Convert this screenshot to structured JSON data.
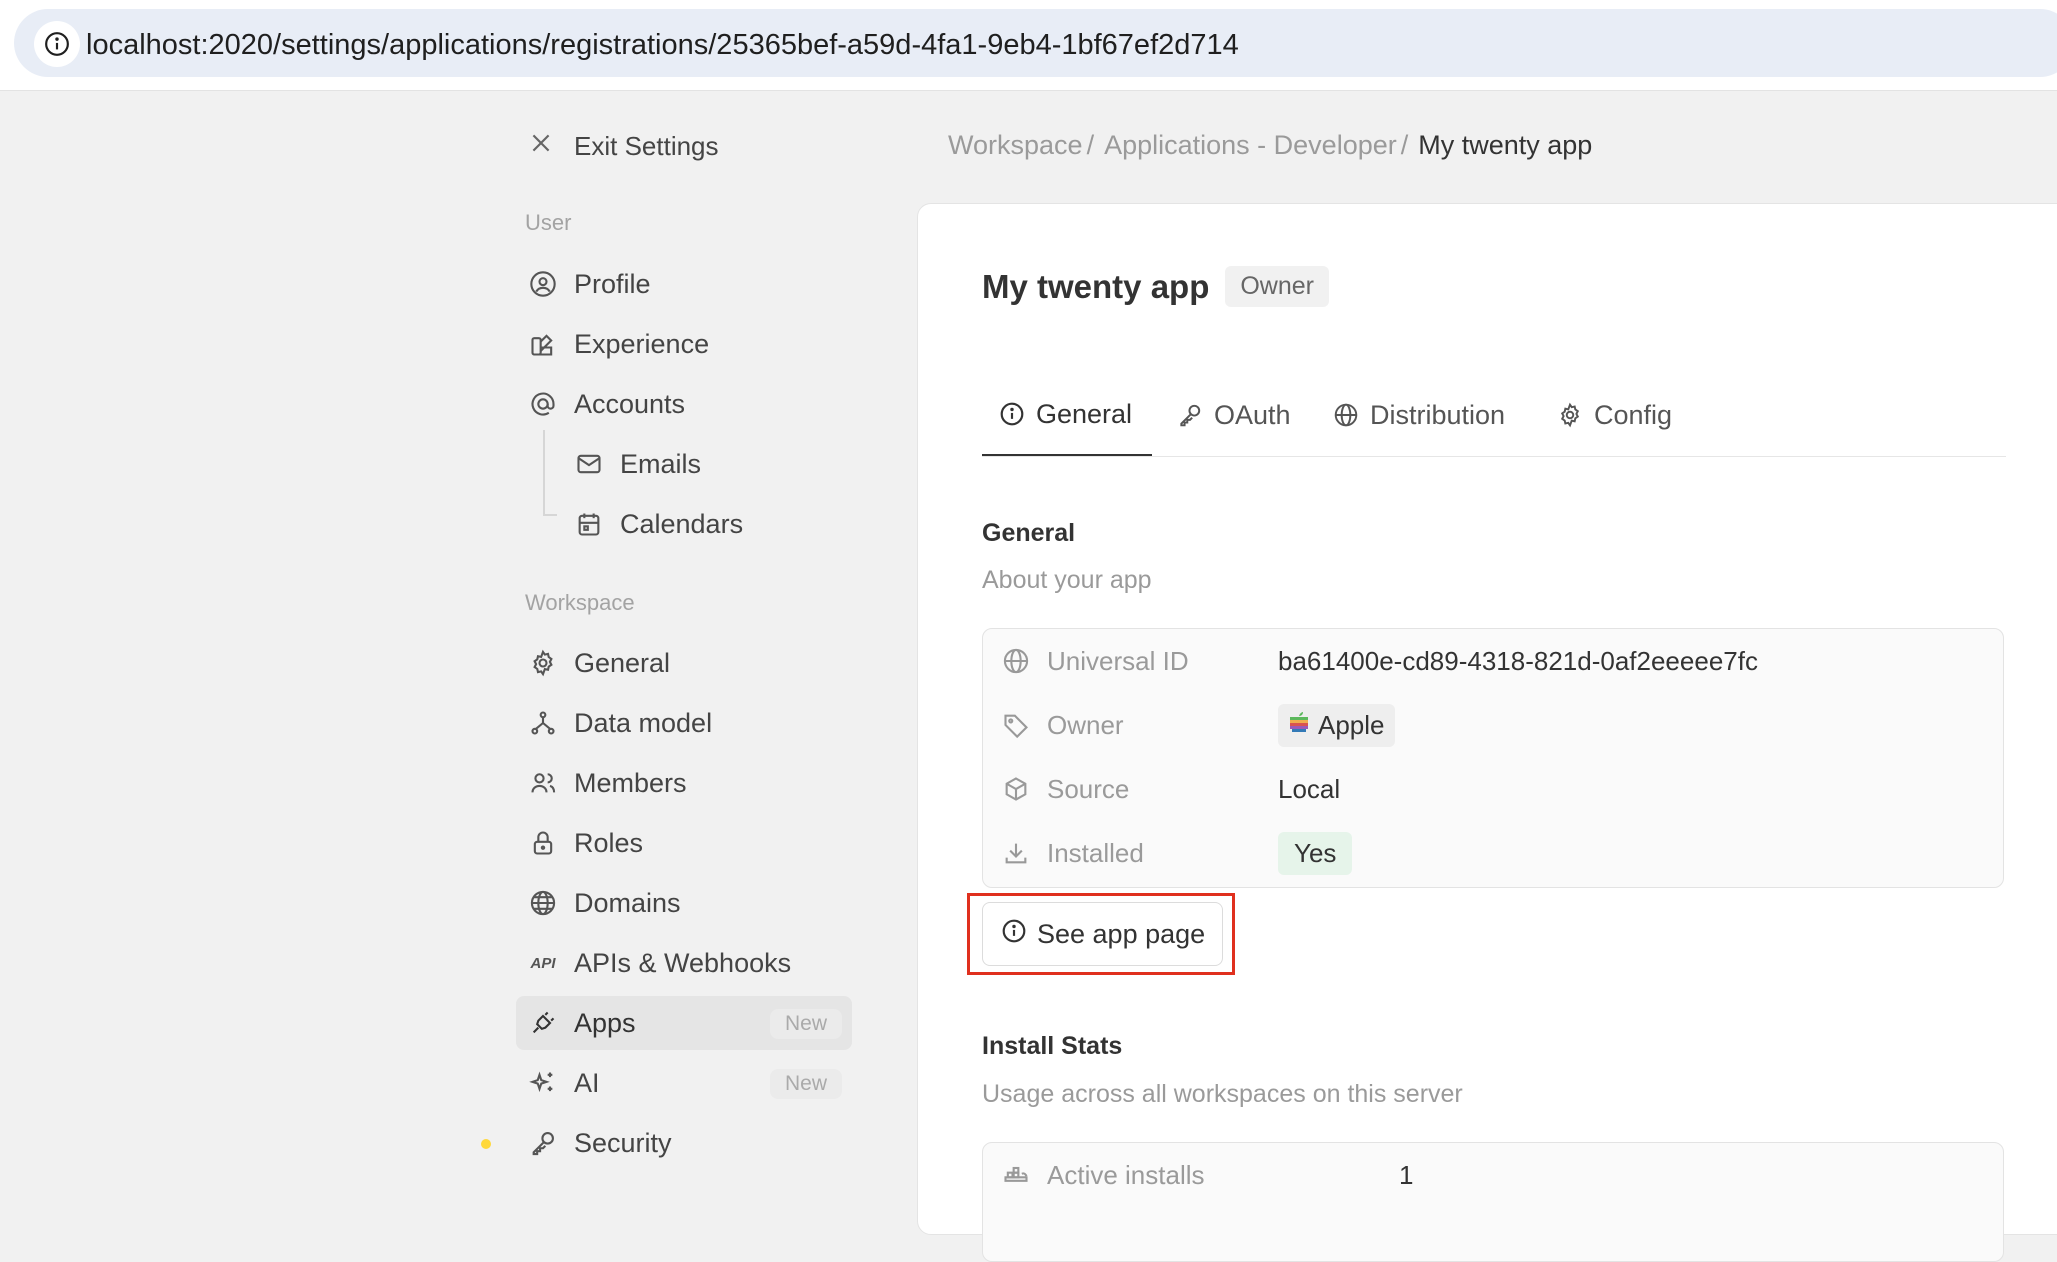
{
  "browser": {
    "url": "localhost:2020/settings/applications/registrations/25365bef-a59d-4fa1-9eb4-1bf67ef2d714"
  },
  "sidebar": {
    "exit_label": "Exit Settings",
    "user_section": "User",
    "user_items": [
      {
        "label": "Profile",
        "icon": "user-circle-icon"
      },
      {
        "label": "Experience",
        "icon": "color-swatch-icon"
      },
      {
        "label": "Accounts",
        "icon": "at-icon"
      },
      {
        "label": "Emails",
        "icon": "mail-icon"
      },
      {
        "label": "Calendars",
        "icon": "calendar-icon"
      }
    ],
    "workspace_section": "Workspace",
    "workspace_items": [
      {
        "label": "General",
        "icon": "gear-icon"
      },
      {
        "label": "Data model",
        "icon": "hierarchy-icon"
      },
      {
        "label": "Members",
        "icon": "users-icon"
      },
      {
        "label": "Roles",
        "icon": "lock-icon"
      },
      {
        "label": "Domains",
        "icon": "globe-icon"
      },
      {
        "label": "APIs & Webhooks",
        "icon": "api-icon"
      },
      {
        "label": "Apps",
        "icon": "plug-icon",
        "badge": "New",
        "active": true
      },
      {
        "label": "AI",
        "icon": "sparkles-icon",
        "badge": "New"
      },
      {
        "label": "Security",
        "icon": "key-icon"
      }
    ]
  },
  "breadcrumb": {
    "items": [
      "Workspace",
      "Applications - Developer"
    ],
    "separator": "/",
    "current": "My twenty app"
  },
  "main": {
    "title": "My twenty app",
    "role_badge": "Owner",
    "tabs": [
      {
        "label": "General",
        "icon": "info-circle-icon",
        "active": true
      },
      {
        "label": "OAuth",
        "icon": "key-icon"
      },
      {
        "label": "Distribution",
        "icon": "globe-icon"
      },
      {
        "label": "Config",
        "icon": "gear-icon"
      }
    ],
    "general": {
      "title": "General",
      "subtitle": "About your app",
      "rows": [
        {
          "label": "Universal ID",
          "value": "ba61400e-cd89-4318-821d-0af2eeeee7fc",
          "icon": "globe-icon"
        },
        {
          "label": "Owner",
          "value": "Apple",
          "icon": "tag-icon"
        },
        {
          "label": "Source",
          "value": "Local",
          "icon": "box-icon"
        },
        {
          "label": "Installed",
          "value": "Yes",
          "icon": "download-icon"
        }
      ],
      "see_app_page": "See app page"
    },
    "install_stats": {
      "title": "Install Stats",
      "subtitle": "Usage across all workspaces on this server",
      "rows": [
        {
          "label": "Active installs",
          "value": "1",
          "icon": "stack-icon"
        }
      ]
    }
  },
  "colors": {
    "highlight": "#e0301e",
    "installed_green": "#2e7d4f",
    "background": "#f1f1f1"
  }
}
